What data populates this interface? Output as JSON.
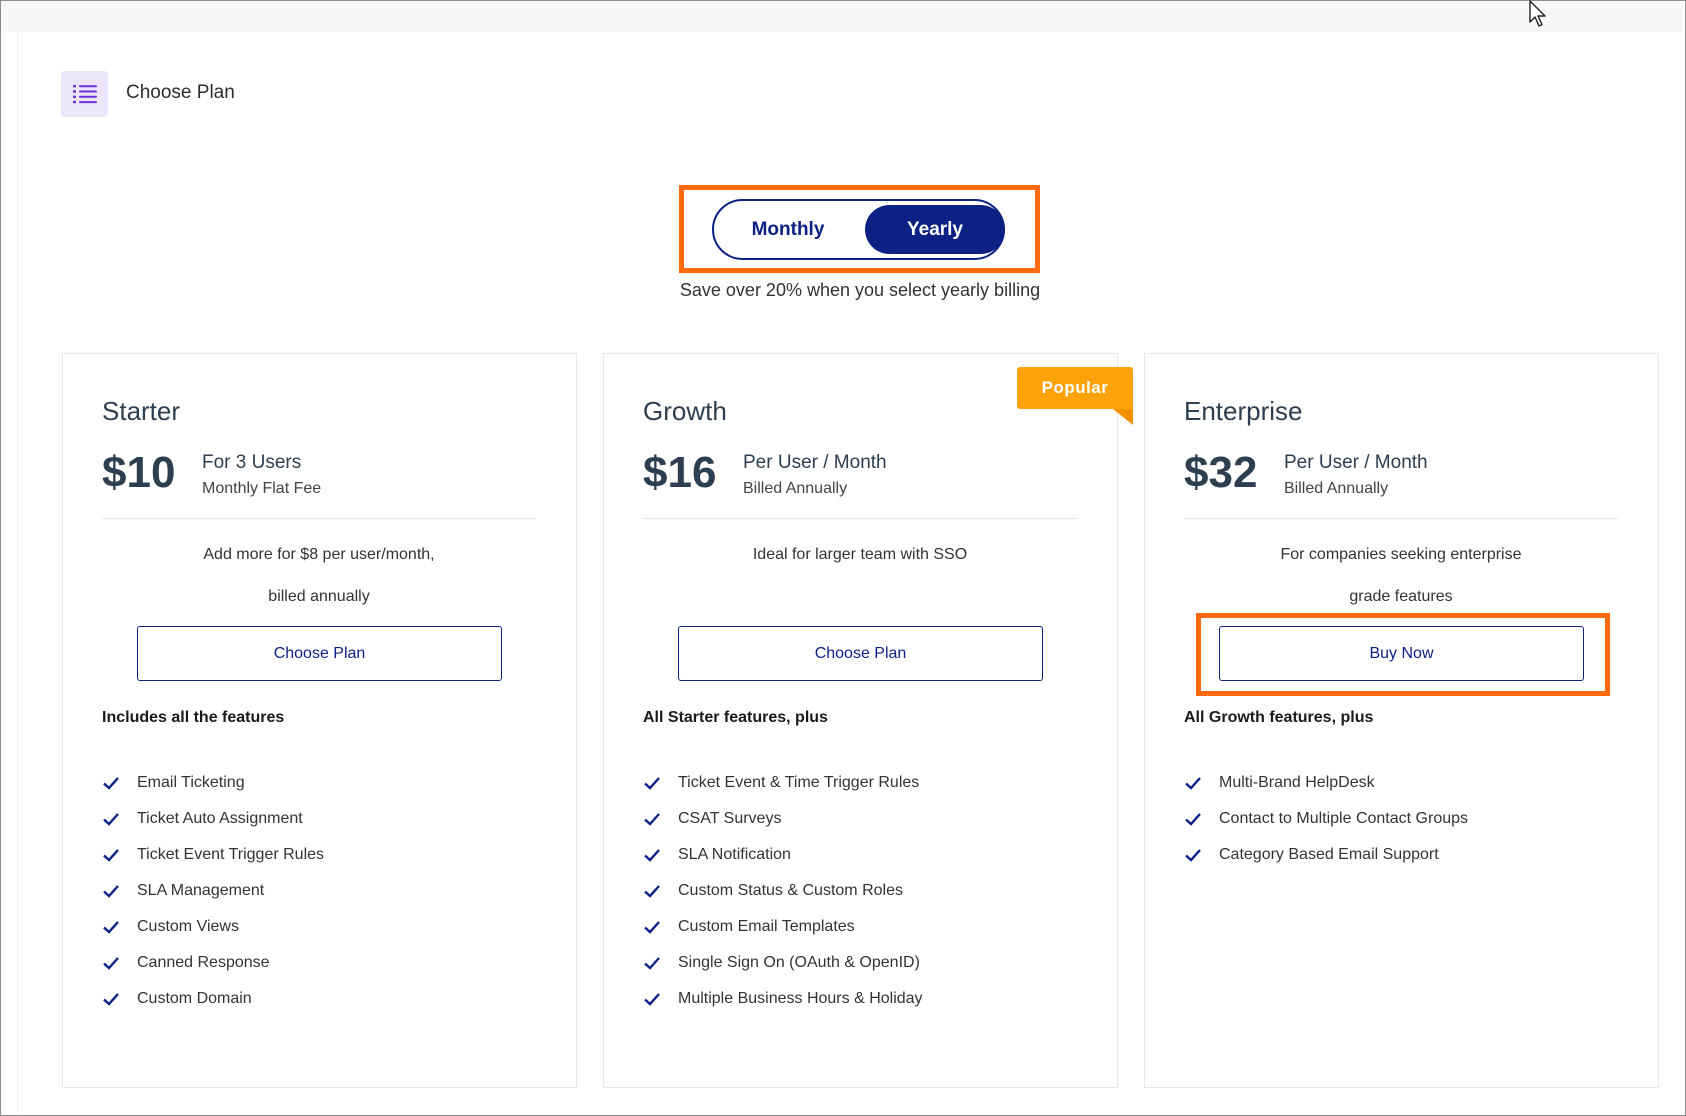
{
  "header": {
    "title": "Choose Plan"
  },
  "billing": {
    "monthly_label": "Monthly",
    "yearly_label": "Yearly",
    "selected": "Yearly",
    "note": "Save over 20% when you select yearly billing"
  },
  "colors": {
    "brand": "#0d2185",
    "highlight": "#ff6a0d",
    "popular": "#ffa20a"
  },
  "plans": [
    {
      "name": "Starter",
      "price": "$10",
      "price_line1": "For 3 Users",
      "price_line2": "Monthly Flat Fee",
      "desc_line1": "Add more for $8 per user/month,",
      "desc_line2": "billed annually",
      "cta": "Choose Plan",
      "includes": "Includes all the features",
      "features": [
        "Email Ticketing",
        "Ticket Auto Assignment",
        "Ticket Event Trigger Rules",
        "SLA Management",
        "Custom Views",
        "Canned Response",
        "Custom Domain"
      ]
    },
    {
      "name": "Growth",
      "badge": "Popular",
      "price": "$16",
      "price_line1": "Per User / Month",
      "price_line2": "Billed Annually",
      "desc_line1": "Ideal for larger team with SSO",
      "desc_line2": "",
      "cta": "Choose Plan",
      "includes": "All Starter features, plus",
      "features": [
        "Ticket Event & Time Trigger Rules",
        "CSAT Surveys",
        "SLA Notification",
        "Custom Status & Custom Roles",
        "Custom Email Templates",
        "Single Sign On (OAuth & OpenID)",
        "Multiple Business Hours & Holiday"
      ]
    },
    {
      "name": "Enterprise",
      "price": "$32",
      "price_line1": "Per User / Month",
      "price_line2": "Billed Annually",
      "desc_line1": "For companies seeking enterprise",
      "desc_line2": "grade features",
      "cta": "Buy Now",
      "includes": "All Growth features, plus",
      "features": [
        "Multi-Brand HelpDesk",
        "Contact to Multiple Contact Groups",
        "Category Based Email Support"
      ]
    }
  ]
}
